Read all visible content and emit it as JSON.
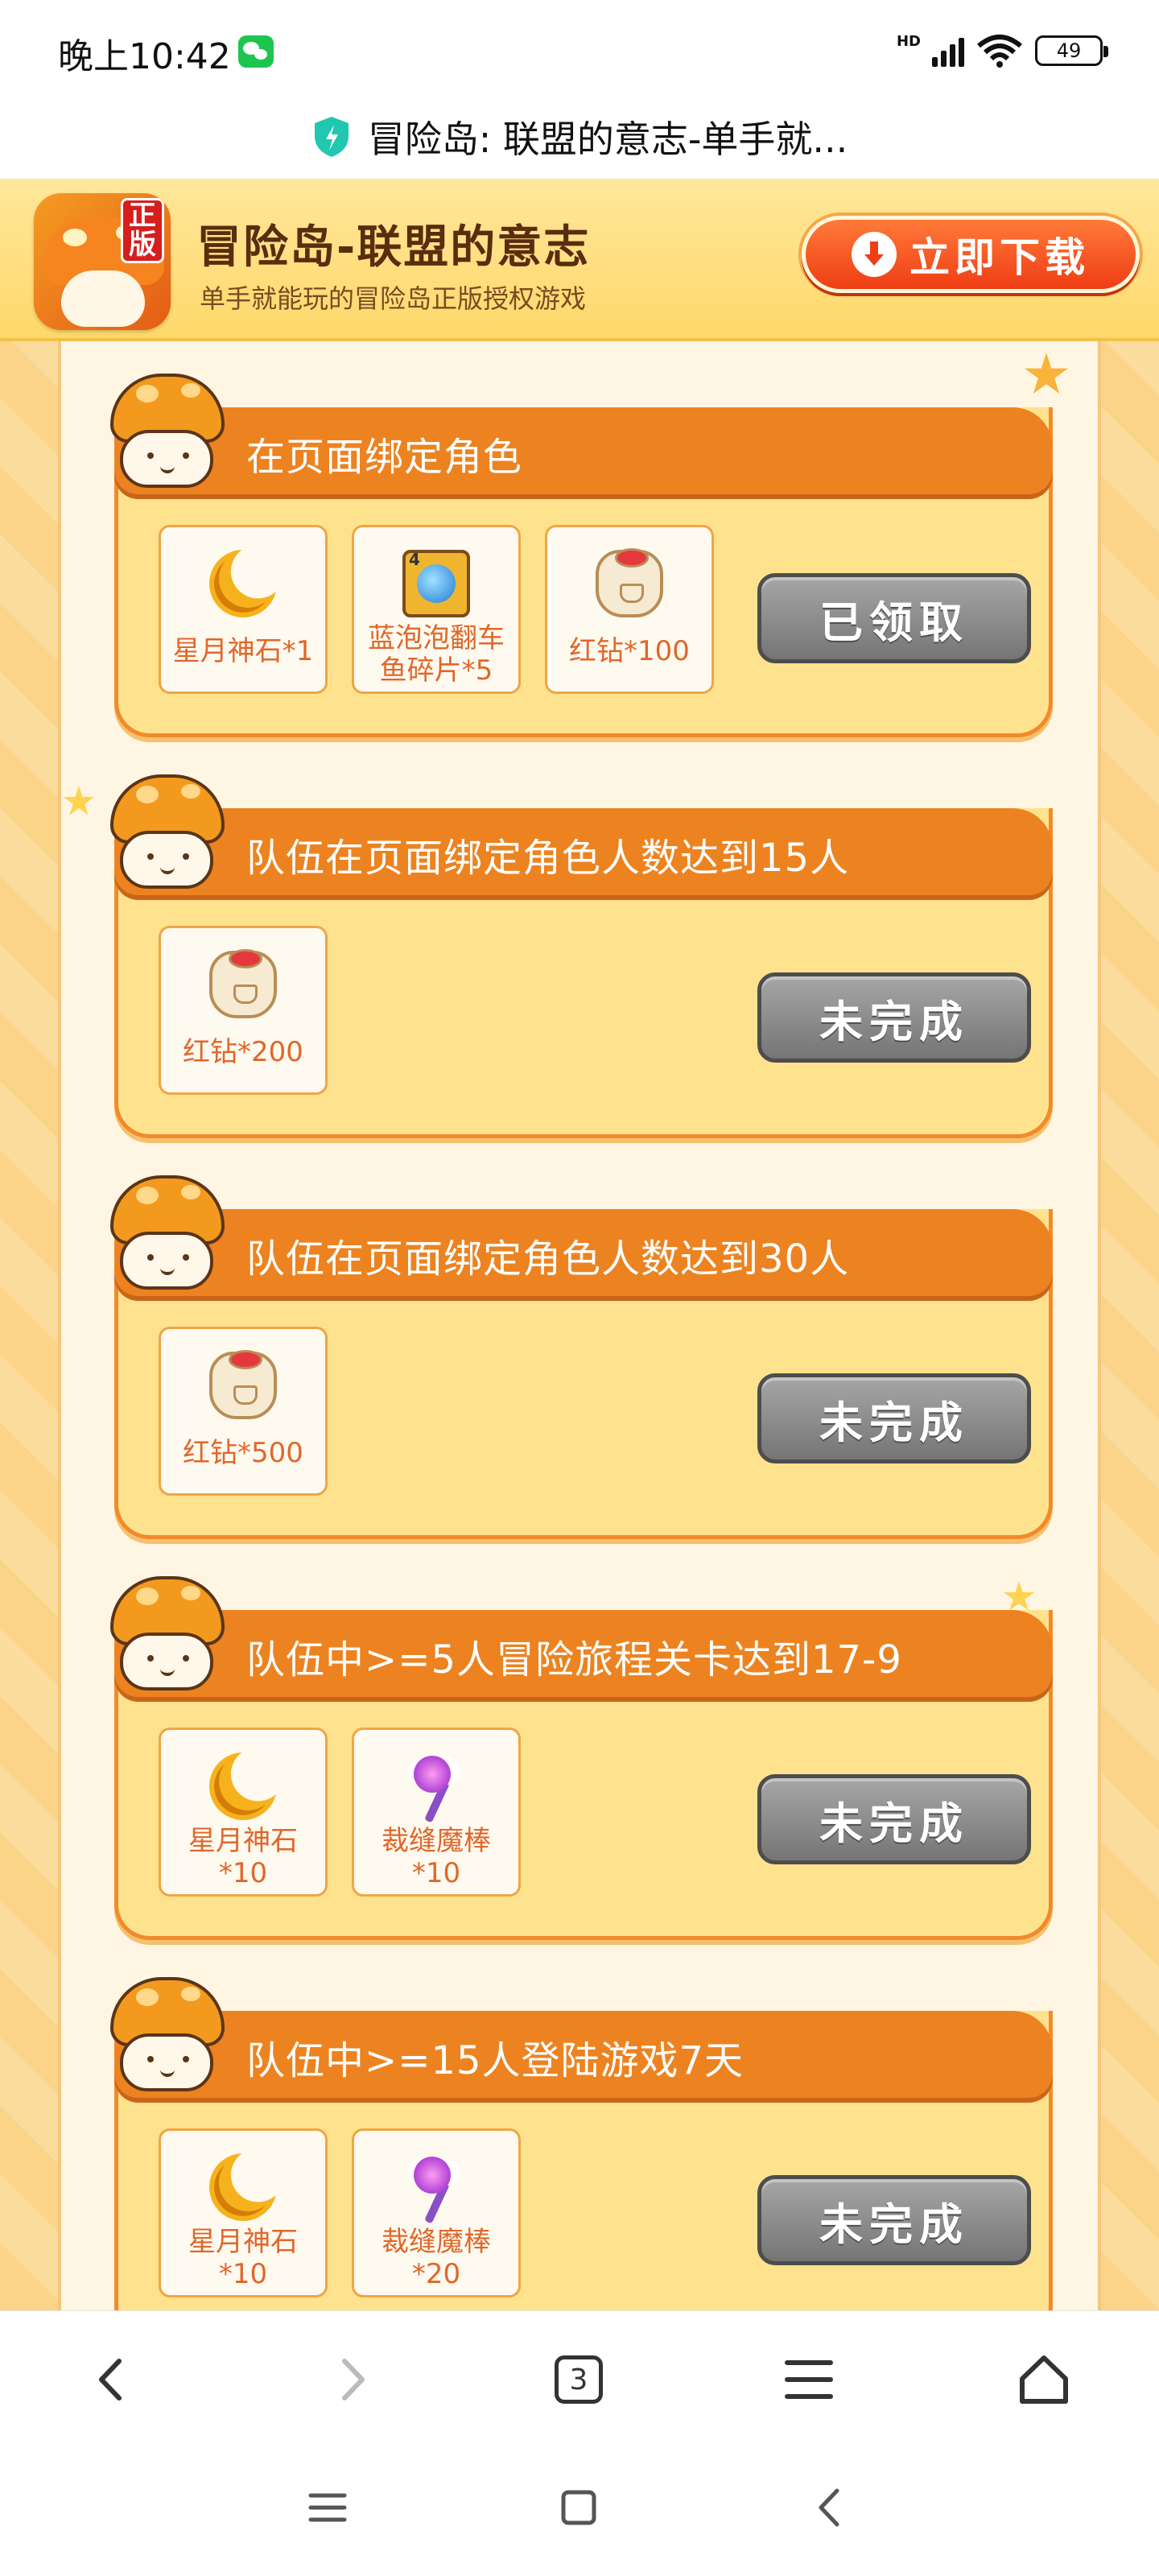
{
  "status_bar": {
    "time": "晚上10:42",
    "network": "HD",
    "battery": "49",
    "icons": [
      "wechat-icon",
      "signal-icon",
      "wifi-icon",
      "battery-icon"
    ]
  },
  "browser": {
    "page_title": "冒险岛: 联盟的意志-单手就...",
    "tab_count": "3"
  },
  "banner": {
    "app_badge": "正版",
    "title": "冒险岛-联盟的意志",
    "subtitle": "单手就能玩的冒险岛正版授权游戏",
    "download_label": "立即下载"
  },
  "tasks": [
    {
      "title": "在页面绑定角色",
      "rewards": [
        {
          "icon": "moon-stone-icon",
          "label_line1": "星月神石*1",
          "label_line2": ""
        },
        {
          "icon": "fish-fragment-icon",
          "label_line1": "蓝泡泡翻车",
          "label_line2": "鱼碎片*5"
        },
        {
          "icon": "red-diamond-bag-icon",
          "label_line1": "红钻*100",
          "label_line2": ""
        }
      ],
      "status": "已领取"
    },
    {
      "title": "队伍在页面绑定角色人数达到15人",
      "rewards": [
        {
          "icon": "red-diamond-bag-icon",
          "label_line1": "红钻*200",
          "label_line2": ""
        }
      ],
      "status": "未完成"
    },
    {
      "title": "队伍在页面绑定角色人数达到30人",
      "rewards": [
        {
          "icon": "red-diamond-bag-icon",
          "label_line1": "红钻*500",
          "label_line2": ""
        }
      ],
      "status": "未完成"
    },
    {
      "title": "队伍中>=5人冒险旅程关卡达到17-9",
      "rewards": [
        {
          "icon": "moon-stone-icon",
          "label_line1": "星月神石",
          "label_line2": "*10"
        },
        {
          "icon": "magic-wand-icon",
          "label_line1": "裁缝魔棒",
          "label_line2": "*10"
        }
      ],
      "status": "未完成"
    },
    {
      "title": "队伍中>=15人登陆游戏7天",
      "rewards": [
        {
          "icon": "moon-stone-icon",
          "label_line1": "星月神石",
          "label_line2": "*10"
        },
        {
          "icon": "magic-wand-icon",
          "label_line1": "裁缝魔棒",
          "label_line2": "*20"
        }
      ],
      "status": "未完成"
    }
  ],
  "nav": {
    "browser_icons": [
      "back-icon",
      "forward-icon",
      "tabs-icon",
      "menu-icon",
      "home-icon"
    ],
    "system_icons": [
      "recents-icon",
      "home-square-icon",
      "system-back-icon"
    ]
  },
  "colors": {
    "accent_orange": "#ec8320",
    "card_fill": "#ffe28d",
    "button_gray": "#757575",
    "download_red": "#ef3d14"
  }
}
